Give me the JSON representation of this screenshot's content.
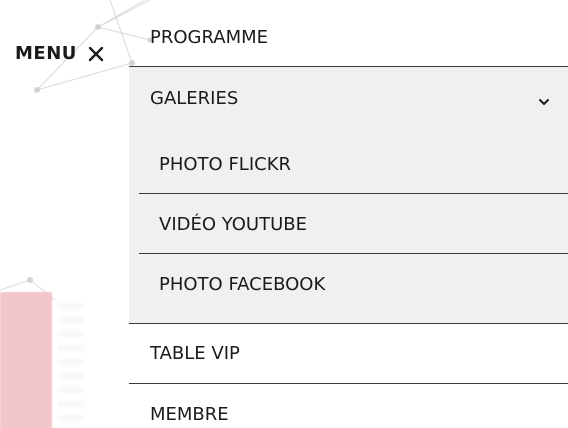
{
  "header": {
    "menu_label": "MENU",
    "close_icon": "close-icon"
  },
  "menu": {
    "items": [
      {
        "label": "PROGRAMME"
      },
      {
        "label": "GALERIES",
        "icon": "chevron-down-icon",
        "expanded": true
      },
      {
        "label": "TABLE VIP"
      },
      {
        "label": "MEMBRE"
      }
    ],
    "galeries_submenu": [
      {
        "label": "PHOTO FLICKR"
      },
      {
        "label": "VIDÉO YOUTUBE"
      },
      {
        "label": "PHOTO FACEBOOK"
      }
    ]
  },
  "colors": {
    "submenu_background": "#f0f0f0",
    "divider": "#3b3b3b",
    "text": "#1b1b1b",
    "decor_pink": "#f2c6cb",
    "decor_network": "#d7d7d7"
  }
}
